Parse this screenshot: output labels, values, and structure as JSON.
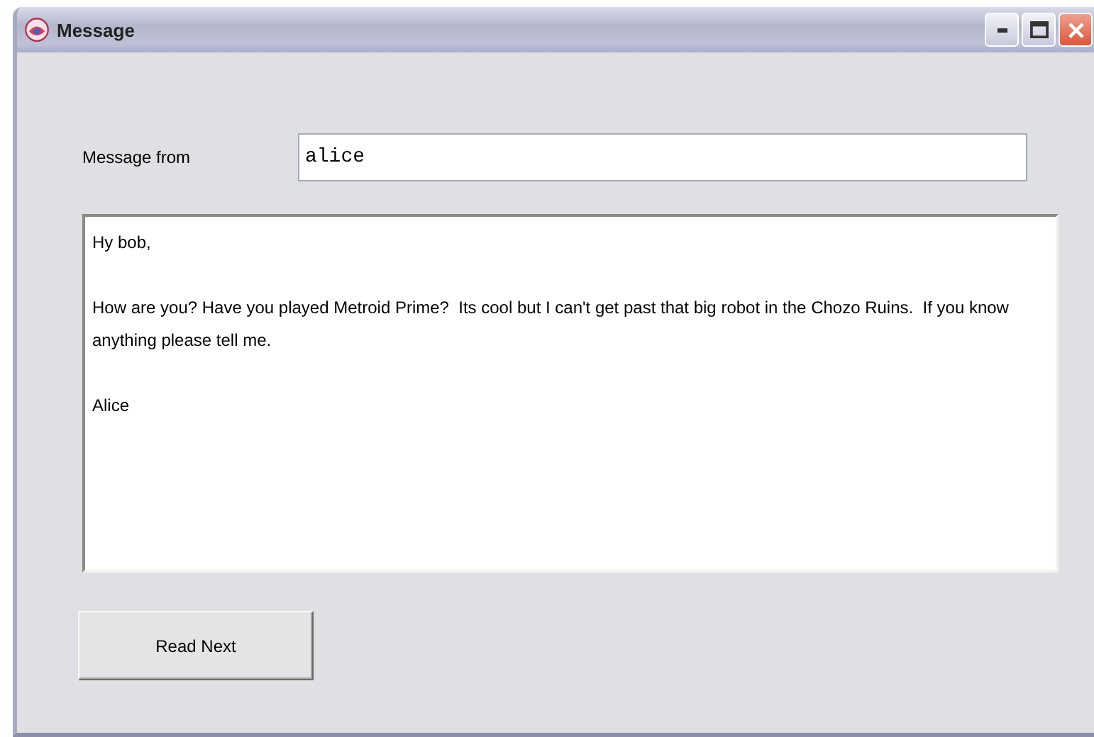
{
  "window": {
    "title": "Message"
  },
  "from_label": "Message from",
  "from_field": {
    "value": "alice"
  },
  "message": {
    "paragraphs": [
      "Hy bob,",
      "How are you? Have you played Metroid Prime?  Its cool but I can't get past that big robot in the Chozo Ruins.  If you know anything please tell me.",
      "Alice"
    ]
  },
  "buttons": [
    {
      "label": "Read Next"
    }
  ]
}
